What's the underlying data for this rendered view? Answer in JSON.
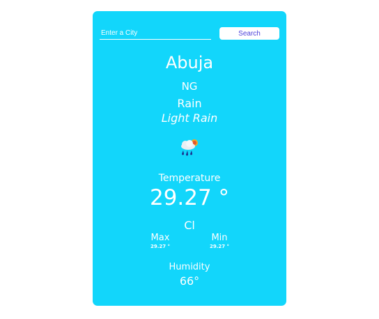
{
  "search": {
    "placeholder": "Enter a City",
    "button_label": "Search"
  },
  "weather": {
    "city": "Abuja",
    "country": "NG",
    "main": "Rain",
    "description": "Light Rain",
    "icon": "rain-cloud-sun-icon",
    "temperature_label": "Temperature",
    "temperature_value": "29.27 °",
    "unit": "Cl",
    "max_label": "Max",
    "max_value": "29.27 °",
    "min_label": "Min",
    "min_value": "29.27 °",
    "humidity_label": "Humidity",
    "humidity_value": "66°"
  },
  "colors": {
    "card_background": "#12d6fb",
    "button_text": "#4a3fd9",
    "text": "#ffffff"
  }
}
